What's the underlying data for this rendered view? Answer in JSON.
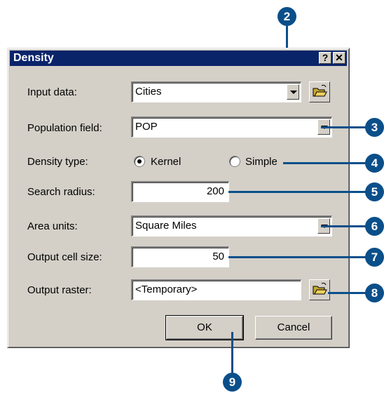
{
  "dialog": {
    "title": "Density",
    "help_label": "?",
    "close_label": "✕"
  },
  "fields": {
    "input_data": {
      "label": "Input data:",
      "value": "Cities"
    },
    "population_field": {
      "label": "Population field:",
      "value": "POP"
    },
    "density_type": {
      "label": "Density type:",
      "options": [
        "Kernel",
        "Simple"
      ],
      "selected": "Kernel"
    },
    "search_radius": {
      "label": "Search radius:",
      "value": "200"
    },
    "area_units": {
      "label": "Area units:",
      "value": "Square Miles"
    },
    "output_cell_size": {
      "label": "Output cell size:",
      "value": "50"
    },
    "output_raster": {
      "label": "Output raster:",
      "value": "<Temporary>"
    }
  },
  "buttons": {
    "ok": "OK",
    "cancel": "Cancel"
  },
  "callouts": [
    "2",
    "3",
    "4",
    "5",
    "6",
    "7",
    "8",
    "9"
  ],
  "icons": {
    "browse": "open-folder-icon",
    "dropdown": "chevron-down-icon",
    "radio": "radio-button"
  },
  "colors": {
    "titlebar": "#0a246a",
    "dialog_bg": "#d4d0c8",
    "callout": "#0a4f8a"
  }
}
